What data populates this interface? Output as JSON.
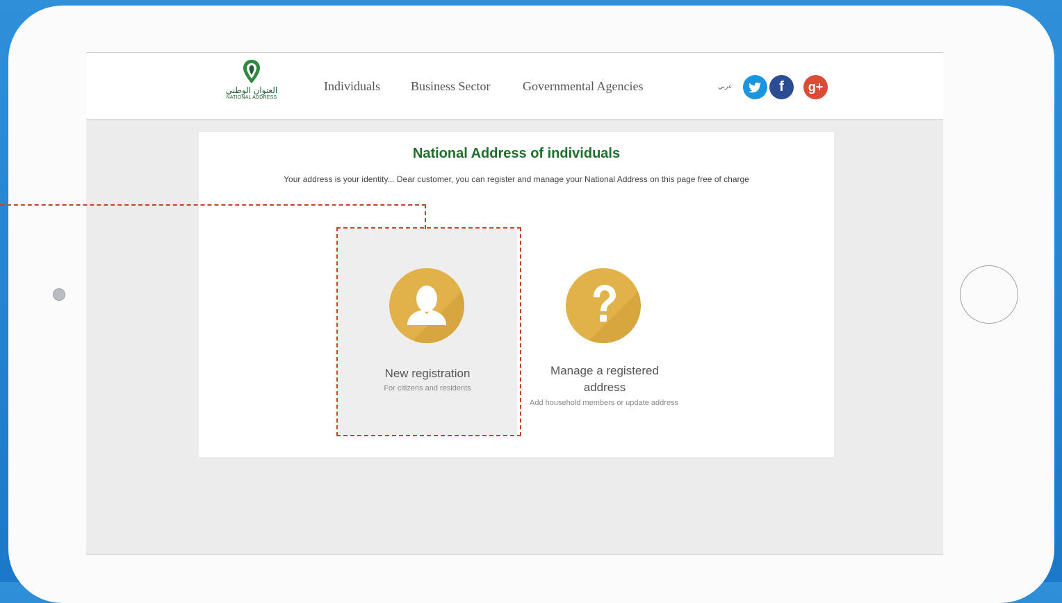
{
  "nav": {
    "logo_arabic": "العنوان الوطني",
    "logo_english": "NATIONAL ADDRESS",
    "links": [
      "Individuals",
      "Business Sector",
      "Governmental Agencies"
    ],
    "language_label": "عربي",
    "social": {
      "twitter_glyph": "t",
      "facebook_glyph": "f",
      "googleplus_glyph": "g+"
    }
  },
  "main": {
    "title": "National Address of individuals",
    "subtitle": "Your address is your identity... Dear customer, you can register and manage your National Address on this page free of charge",
    "options": [
      {
        "title": "New registration",
        "subtitle": "For citizens and residents",
        "icon": "user-icon"
      },
      {
        "title": "Manage a registered address",
        "subtitle": "Add household members or update address",
        "icon": "question-icon"
      }
    ]
  },
  "colors": {
    "brand_green": "#1e6e2c",
    "icon_gold": "#e2b24a",
    "callout_red": "#c0462a",
    "frame_blue": "#2f8fd9"
  }
}
